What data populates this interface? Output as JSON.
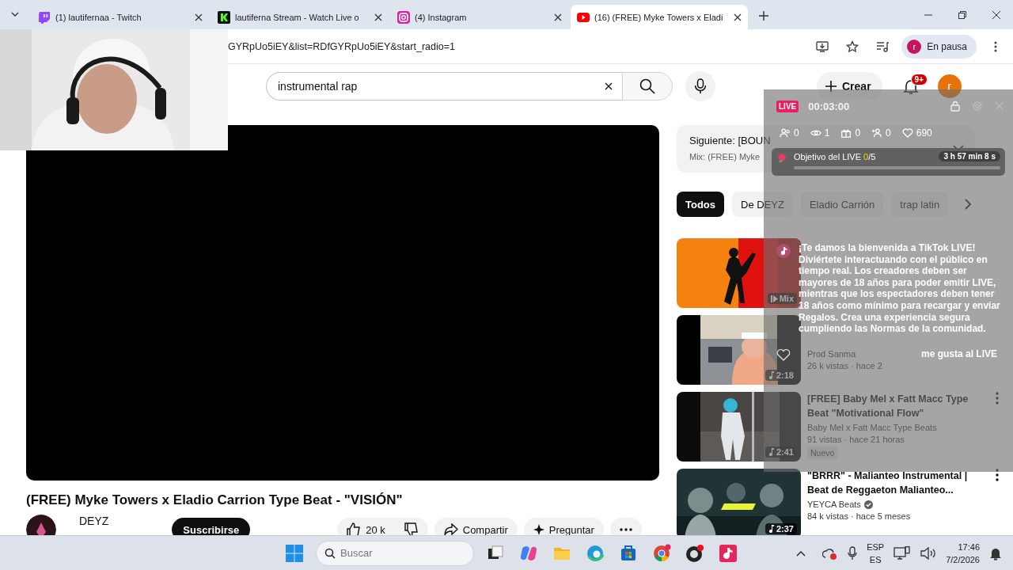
{
  "browser": {
    "tabs": [
      {
        "title": "(1) lautifernaa - Twitch",
        "selected": false
      },
      {
        "title": "lautiferna Stream - Watch Live o",
        "selected": false
      },
      {
        "title": "(4) Instagram",
        "selected": false
      },
      {
        "title": "(16) (FREE) Myke Towers x Eladi",
        "selected": true
      }
    ],
    "address": "GYRpUo5iEY&list=RDfGYRpUo5iEY&start_radio=1",
    "profile": {
      "initial": "r",
      "status": "En pausa"
    }
  },
  "youtube": {
    "search": {
      "value": "instrumental rap"
    },
    "create": "Crear",
    "notifications": "9+",
    "avatar": "r",
    "video": {
      "title": "(FREE) Myke Towers x Eladio Carrion Type Beat - \"VISIÓN\"",
      "channel": "DEYZ",
      "subscribe": "Suscribirse",
      "likes": "20 k",
      "share": "Compartir",
      "ask": "Preguntar"
    },
    "next": {
      "title": "Siguiente: [BOUN",
      "subtitle": "Mix: (FREE) Myke"
    },
    "chips": [
      {
        "label": "Todos",
        "selected": true
      },
      {
        "label": "De DEYZ",
        "selected": false
      },
      {
        "label": "Eladio Carrión",
        "selected": false
      },
      {
        "label": "trap latin",
        "selected": false
      }
    ],
    "recommendations": [
      {
        "kind": "mix",
        "badge": "Mix"
      },
      {
        "kind": "video",
        "channel": "Prod Sanma",
        "meta": "26 k vistas · hace 2",
        "badge": "2:18"
      },
      {
        "kind": "video",
        "title": "[FREE] Baby Mel x Fatt Macc Type Beat \"Motivational Flow\"",
        "channel": "Baby Mel x Fatt Macc Type Beats",
        "meta": "91 vistas · hace 21 horas",
        "tag": "Nuevo",
        "badge": "2:41"
      },
      {
        "kind": "video",
        "title": "\"BRRR\" - Malianteo Instrumental | Beat de Reggaeton Malianteo...",
        "channel": "YEYCA Beats",
        "verified": true,
        "meta": "84 k vistas · hace 5 meses",
        "badge": "2:37"
      }
    ]
  },
  "live_panel": {
    "badge": "LIVE",
    "timer": "00:03:00",
    "stats": [
      {
        "kind": "guests",
        "value": "0"
      },
      {
        "kind": "viewers",
        "value": "1"
      },
      {
        "kind": "gifts",
        "value": "0"
      },
      {
        "kind": "followers",
        "value": "0"
      },
      {
        "kind": "likes",
        "value": "690"
      }
    ],
    "goal": {
      "label": "Objetivo del LIVE",
      "current": "0",
      "total": "/5",
      "remaining": "3 h 57 min 8 s",
      "level": 0
    },
    "welcome": "¡Te damos la bienvenida a TikTok LIVE! Diviértete interactuando con el público en tiempo real. Los creadores deben ser mayores de 18 años para poder emitir LIVE, mientras que los espectadores deben tener 18 años como mínimo para recargar y enviar Regalos. Crea una experiencia segura cumpliendo las Normas de la comunidad.",
    "like_hint": "me gusta al LIVE"
  },
  "taskbar": {
    "search": {
      "placeholder": "Buscar"
    },
    "language": "ESP",
    "layout": "ES",
    "time": "17:46",
    "date": "7/2/2026"
  }
}
